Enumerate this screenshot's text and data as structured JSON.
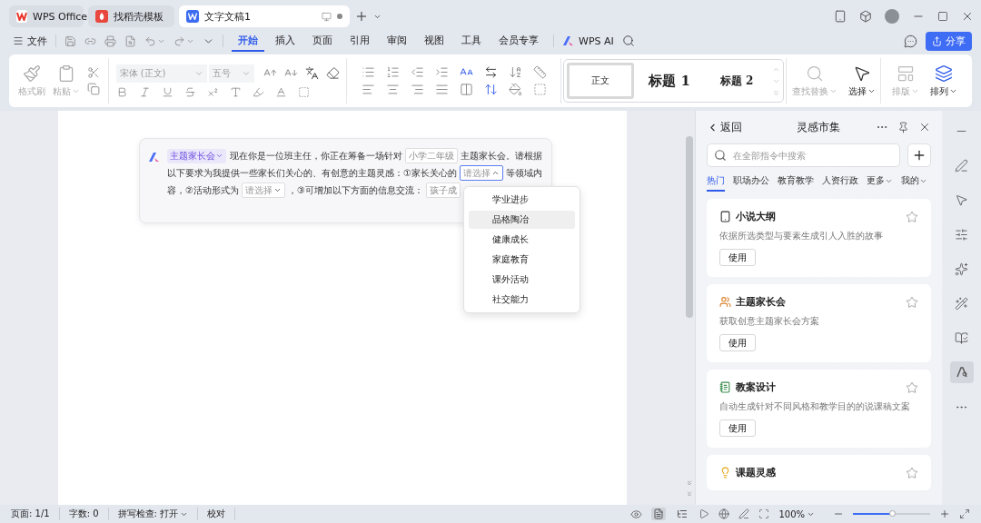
{
  "tabs": [
    {
      "label": "WPS Office",
      "selected": false,
      "kind": "home"
    },
    {
      "label": "找稻壳模板",
      "selected": false,
      "kind": "template"
    },
    {
      "label": "文字文稿1",
      "selected": true,
      "kind": "document",
      "unsaved": true
    }
  ],
  "menu": {
    "file": "文件",
    "tabs": [
      {
        "label": "开始",
        "selected": true
      },
      {
        "label": "插入",
        "selected": false
      },
      {
        "label": "页面",
        "selected": false
      },
      {
        "label": "引用",
        "selected": false
      },
      {
        "label": "审阅",
        "selected": false
      },
      {
        "label": "视图",
        "selected": false
      },
      {
        "label": "工具",
        "selected": false
      },
      {
        "label": "会员专享",
        "selected": false
      }
    ],
    "ai": "WPS AI",
    "share": "分享"
  },
  "ribbon": {
    "clipboard": [
      {
        "label": "格式刷",
        "disabled": true
      },
      {
        "label": "粘贴",
        "disabled": true
      }
    ],
    "font": "宋体 (正文)",
    "size": "五号",
    "styles": [
      {
        "label": "正文",
        "selected": true
      },
      {
        "label": "标题 1",
        "selected": false
      },
      {
        "label": "标题 2",
        "selected": false
      }
    ],
    "tools": [
      {
        "label": "查找替换",
        "disabled": true
      },
      {
        "label": "选择",
        "disabled": false
      },
      {
        "label": "排版",
        "disabled": true
      },
      {
        "label": "排列",
        "disabled": false
      }
    ]
  },
  "prompt": {
    "tag": "主题家长会",
    "lines": [
      [
        {
          "kind": "text",
          "text": "现在你是一位班主任，你正在筹备一场针对"
        },
        {
          "kind": "field",
          "value": "小学二年级"
        },
        {
          "kind": "text",
          "text": "主题家长会。请根据"
        }
      ],
      [
        {
          "kind": "text",
          "text": "以下要求为我提供一些家长们关心的、有创意的主题灵感：①家长关心的"
        },
        {
          "kind": "select",
          "placeholder": "请选择",
          "expanded": true
        },
        {
          "kind": "text",
          "text": "等领域内"
        }
      ],
      [
        {
          "kind": "text",
          "text": "容，②活动形式为"
        },
        {
          "kind": "select",
          "placeholder": "请选择",
          "expanded": false
        },
        {
          "kind": "text",
          "text": "，③可增加以下方面的信息交流："
        },
        {
          "kind": "field",
          "value": "孩子成"
        }
      ]
    ],
    "options": [
      {
        "label": "学业进步",
        "selected": false
      },
      {
        "label": "品格陶冶",
        "selected": true
      },
      {
        "label": "健康成长",
        "selected": false
      },
      {
        "label": "家庭教育",
        "selected": false
      },
      {
        "label": "课外活动",
        "selected": false
      },
      {
        "label": "社交能力",
        "selected": false
      }
    ]
  },
  "panel": {
    "back": "返回",
    "title": "灵感市集",
    "search": {
      "placeholder": "在全部指令中搜索"
    },
    "categories": [
      {
        "label": "热门",
        "selected": true,
        "dropdown": false
      },
      {
        "label": "职场办公",
        "selected": false,
        "dropdown": false
      },
      {
        "label": "教育教学",
        "selected": false,
        "dropdown": false
      },
      {
        "label": "人资行政",
        "selected": false,
        "dropdown": false
      },
      {
        "label": "更多",
        "selected": false,
        "dropdown": true
      },
      {
        "label": "我的",
        "selected": false,
        "dropdown": true
      }
    ],
    "cards": [
      {
        "title": "小说大纲",
        "description": "依据所选类型与要素生成引人入胜的故事",
        "button": "使用"
      },
      {
        "title": "主题家长会",
        "description": "获取创意主题家长会方案",
        "button": "使用"
      },
      {
        "title": "教案设计",
        "description": "自动生成针对不同风格和教学目的的说课稿文案",
        "button": "使用"
      },
      {
        "title": "课题灵感"
      }
    ]
  },
  "rail": [
    {
      "selected": false
    },
    {
      "selected": false
    },
    {
      "selected": false
    },
    {
      "selected": false
    },
    {
      "selected": false
    },
    {
      "selected": false
    },
    {
      "selected": false
    },
    {
      "selected": true
    },
    {
      "selected": false
    }
  ],
  "status": {
    "items": [
      "页面: 1/1",
      "字数: 0",
      "拼写检查: 打开",
      "校对"
    ],
    "views": [
      {
        "selected": true
      },
      {
        "selected": false
      }
    ],
    "zoom": "100%",
    "zoom_level": {
      "level": 0.5
    }
  }
}
